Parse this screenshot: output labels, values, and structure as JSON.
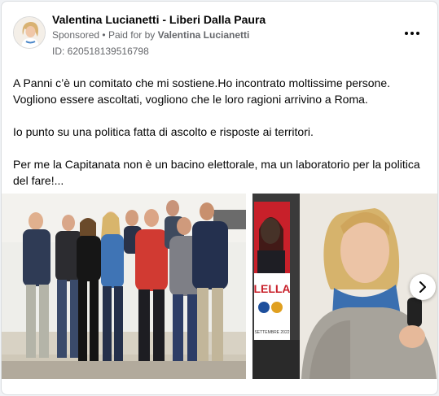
{
  "post": {
    "page_name": "Valentina Lucianetti - Liberi Dalla Paura",
    "sponsored": "Sponsored",
    "separator": "•",
    "paid_prefix": "Paid for by",
    "paid_by": "Valentina Lucianetti",
    "ad_id": "ID: 620518139516798",
    "paragraphs": [
      "A Panni c’è un comitato che mi sostiene.Ho incontrato moltissime persone. Vogliono essere ascoltati, vogliono che le loro ragioni arrivino a Roma.",
      "Io punto su una politica fatta di ascolto e risposte ai territori.",
      "Per me la Capitanata non è un bacino elettorale, ma un laboratorio per la politica del fare!..."
    ]
  },
  "carousel": {
    "poster_text": "LELLA",
    "poster_small": "SETTEMBRE 2022"
  },
  "icons": {
    "more": "more-options-icon",
    "next": "chevron-right-icon"
  },
  "colors": {
    "secondary_text": "#65676b",
    "poster_red": "#c8202a"
  }
}
